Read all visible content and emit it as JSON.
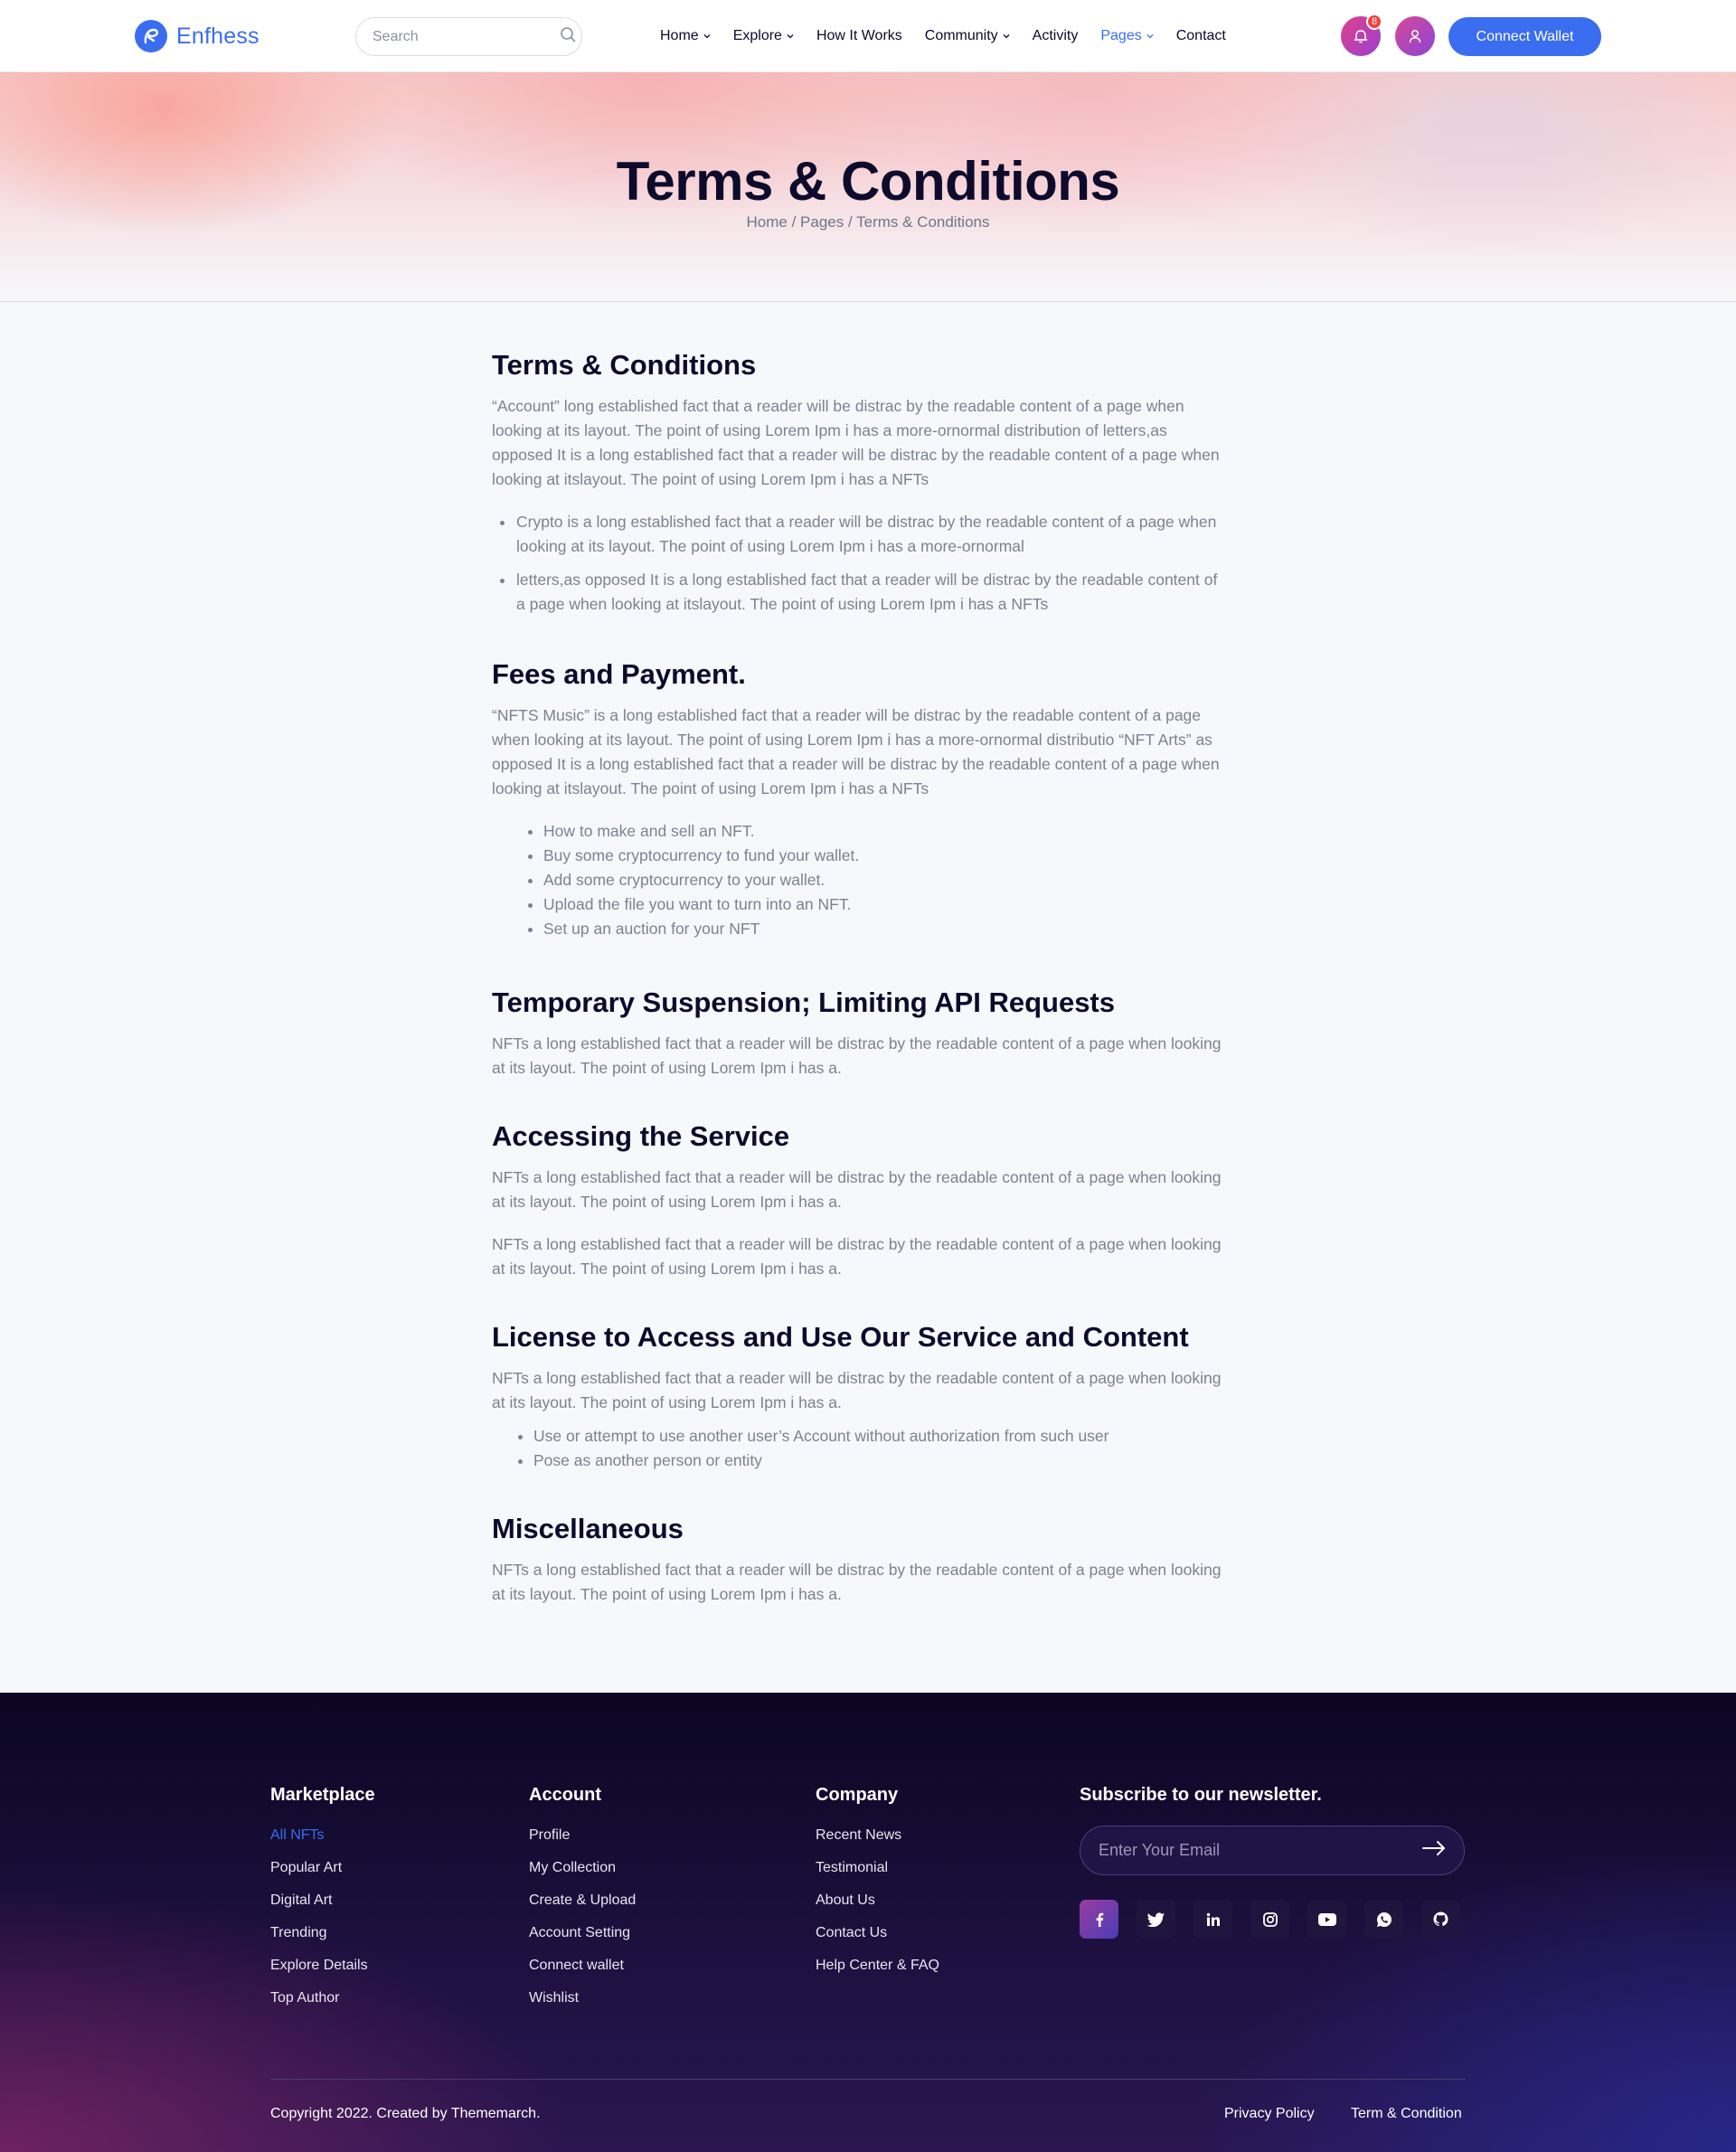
{
  "header": {
    "brand": "Enfhess",
    "search_placeholder": "Search",
    "nav": [
      {
        "label": "Home",
        "dropdown": true
      },
      {
        "label": "Explore",
        "dropdown": true
      },
      {
        "label": "How It Works",
        "dropdown": false
      },
      {
        "label": "Community",
        "dropdown": true
      },
      {
        "label": "Activity",
        "dropdown": false
      },
      {
        "label": "Pages",
        "dropdown": true
      },
      {
        "label": "Contact",
        "dropdown": false
      }
    ],
    "notification_count": "8",
    "connect_wallet": "Connect Wallet"
  },
  "hero": {
    "title": "Terms & Conditions",
    "breadcrumb": [
      "Home",
      "Pages",
      "Terms & Conditions"
    ],
    "breadcrumb_separator": " / "
  },
  "content": {
    "s1": {
      "title": "Terms & Conditions",
      "para": "“Account” long established fact that a reader will be distrac by the readable content of a page when looking at its layout. The point of using Lorem Ipm i has a more-ornormal distribution of letters,as opposed It is a long established fact that a reader will be distrac by the readable content of a page when looking at itslayout. The point of using Lorem Ipm i has a NFTs",
      "bullets": [
        "Crypto is a long established fact that a reader will be distrac by the readable content of a page when looking at its layout. The point of using Lorem Ipm i has a more-ornormal",
        "letters,as opposed It is a long established fact that a reader will be distrac by the readable content of a page when looking at itslayout. The point of using Lorem Ipm i has a NFTs"
      ]
    },
    "s2": {
      "title": "Fees and Payment.",
      "para": "“NFTS Music” is a long established fact that a reader will be distrac by the readable content of a page when looking at its layout. The point of using Lorem Ipm i has a more-ornormal distributio “NFT Arts” as opposed It is a long established fact that a reader will be distrac by the readable content of a page when looking at itslayout. The point of using Lorem Ipm i has a NFTs",
      "bullets": [
        "How to make and sell an NFT.",
        "Buy some cryptocurrency to fund your wallet.",
        "Add some cryptocurrency to your wallet.",
        "Upload the file you want to turn into an NFT.",
        "Set up an auction for your NFT"
      ]
    },
    "s3": {
      "title": "Temporary Suspension; Limiting API Requests",
      "para": "NFTs a long established fact that a reader will be distrac by the readable content of a page when looking at its layout. The point of using Lorem Ipm i has a."
    },
    "s4": {
      "title": "Accessing the Service",
      "para1": "NFTs a long established fact that a reader will be distrac by the readable content of a page when looking at its layout. The point of using Lorem Ipm i has a.",
      "para2": "NFTs a long established fact that a reader will be distrac by the readable content of a page when looking at its layout. The point of using Lorem Ipm i has a."
    },
    "s5": {
      "title": "License to Access and Use Our Service and Content",
      "para": "NFTs a long established fact that a reader will be distrac by the readable content of a page when looking at its layout. The point of using Lorem Ipm i has a.",
      "bullets": [
        "Use or attempt to use another user’s Account without authorization from such user",
        "Pose as another person or entity"
      ]
    },
    "s6": {
      "title": "Miscellaneous",
      "para": "NFTs a long established fact that a reader will be distrac by the readable content of a page when looking at its layout. The point of using Lorem Ipm i has a."
    }
  },
  "footer": {
    "marketplace": {
      "title": "Marketplace",
      "links": [
        "All NFTs",
        "Popular Art",
        "Digital Art",
        "Trending",
        "Explore Details",
        "Top Author"
      ]
    },
    "account": {
      "title": "Account",
      "links": [
        "Profile",
        "My Collection",
        "Create & Upload",
        "Account Setting",
        "Connect wallet",
        "Wishlist"
      ]
    },
    "company": {
      "title": "Company",
      "links": [
        "Recent News",
        "Testimonial",
        "About Us",
        "Contact Us",
        "Help Center & FAQ"
      ]
    },
    "newsletter": {
      "title": "Subscribe to our newsletter.",
      "placeholder": "Enter Your Email"
    },
    "socials": [
      "facebook-icon",
      "twitter-icon",
      "linkedin-icon",
      "instagram-icon",
      "youtube-icon",
      "whatsapp-icon",
      "github-icon"
    ],
    "copyright": "Copyright 2022. Created by Thememarch.",
    "privacy": "Privacy Policy",
    "terms": "Term & Condition"
  },
  "colors": {
    "accent": "#3a6df0",
    "heading": "#0d0a2c",
    "body_text": "#7b8292",
    "footer_bg": "#1b0f3c"
  }
}
